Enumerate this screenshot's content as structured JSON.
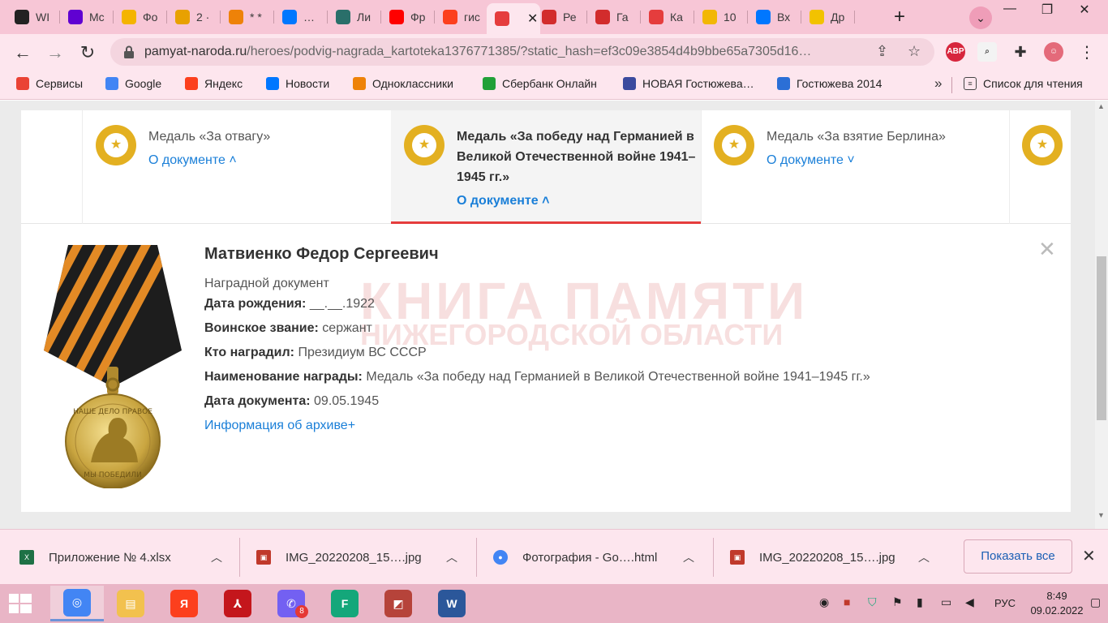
{
  "browser": {
    "tabs": [
      {
        "label": "WI",
        "icon": "github-icon",
        "color": "#222222"
      },
      {
        "label": "Mc",
        "icon": "yahoo-icon",
        "color": "#6001d2"
      },
      {
        "label": "Фо",
        "icon": "google-photos-icon",
        "color": "#f4b400"
      },
      {
        "label": "2 ·",
        "icon": "mail-icon",
        "color": "#e8a100"
      },
      {
        "label": "* *",
        "icon": "odnoklassniki-mail-icon",
        "color": "#ee8208"
      },
      {
        "label": "…",
        "icon": "vk-icon",
        "color": "#0077ff"
      },
      {
        "label": "Ли",
        "icon": "globe-icon",
        "color": "#2a6f6a"
      },
      {
        "label": "Фр",
        "icon": "youtube-icon",
        "color": "#ff0000"
      },
      {
        "label": "гис",
        "icon": "yandex-icon",
        "color": "#fc3f1d"
      },
      {
        "label": "",
        "icon": "star-outline-icon",
        "color": "#e53d3d",
        "active": true
      },
      {
        "label": "Ре",
        "icon": "ribbon-medal-icon",
        "color": "#d22c2c"
      },
      {
        "label": "Га",
        "icon": "ribbon-medal-icon",
        "color": "#d22c2c"
      },
      {
        "label": "Ка",
        "icon": "star-outline-icon",
        "color": "#e53d3d"
      },
      {
        "label": "10",
        "icon": "mountain-icon",
        "color": "#f2b705"
      },
      {
        "label": "Вх",
        "icon": "vk-icon",
        "color": "#0077ff"
      },
      {
        "label": "Др",
        "icon": "sun-icon",
        "color": "#f2c200"
      }
    ],
    "url_host": "pamyat-naroda.ru",
    "url_path": "/heroes/podvig-nagrada_kartoteka1376771385/?static_hash=ef3c09e3854d4b9bbe65a7305d16…",
    "extensions": [
      "ABP"
    ],
    "bookmarks": [
      {
        "label": "Сервисы",
        "icon": "apps-grid-icon",
        "color": "#ea4335"
      },
      {
        "label": "Google",
        "icon": "google-icon",
        "color": "#4285f4"
      },
      {
        "label": "Яндекс",
        "icon": "yandex-icon",
        "color": "#fc3f1d"
      },
      {
        "label": "Новости",
        "icon": "vk-icon",
        "color": "#0077ff"
      },
      {
        "label": "Одноклассники",
        "icon": "mail-icon",
        "color": "#ee8208"
      },
      {
        "label": "Сбербанк Онлайн",
        "icon": "sberbank-icon",
        "color": "#21a038"
      },
      {
        "label": "НОВАЯ Гостюжева…",
        "icon": "page-icon",
        "color": "#3b4a9e"
      },
      {
        "label": "Гостюжева 2014",
        "icon": "page-icon",
        "color": "#2b6fd6"
      }
    ],
    "bookmarks_more": "»",
    "reading_list": "Список для чтения"
  },
  "awards": {
    "tabs": [
      {
        "name": "Медаль «За отвагу»",
        "link": "О документе ˄",
        "active": false
      },
      {
        "name": "Медаль «За победу над Германией в Великой Отечественной войне 1941–1945 гг.»",
        "link": "О документе ˄",
        "active": true
      },
      {
        "name": "Медаль «За взятие Берлина»",
        "link": "О документе ˅",
        "active": false
      }
    ],
    "watermark_line1": "КНИГА ПАМЯТИ",
    "watermark_line2": "НИЖЕГОРОДСКОЙ ОБЛАСТИ",
    "person": {
      "name": "Матвиенко Федор Сергеевич",
      "doc_type": "Наградной документ",
      "fields": [
        {
          "label": "Дата рождения:",
          "value": "__.__.1922"
        },
        {
          "label": "Воинское звание:",
          "value": "сержант"
        },
        {
          "label": "Кто наградил:",
          "value": "Президиум ВС СССР"
        },
        {
          "label": "Наименование награды:",
          "value": "Медаль «За победу над Германией в Великой Отечественной войне 1941–1945 гг.»"
        },
        {
          "label": "Дата документа:",
          "value": "09.05.1945"
        }
      ],
      "archive_link": "Информация об архиве+"
    },
    "medal_inscription_top": "НАШЕ ДЕЛО ПРАВОЕ",
    "medal_inscription_bottom": "МЫ ПОБЕДИЛИ"
  },
  "downloads": {
    "items": [
      {
        "name": "Приложение № 4.xlsx",
        "icon": "excel-file-icon",
        "color": "#1e7145"
      },
      {
        "name": "IMG_20220208_15….jpg",
        "icon": "image-file-icon",
        "color": "#c0392b"
      },
      {
        "name": "Фотография - Go….html",
        "icon": "chrome-icon",
        "color": "#4285f4"
      },
      {
        "name": "IMG_20220208_15….jpg",
        "icon": "image-file-icon",
        "color": "#c0392b"
      }
    ],
    "show_all": "Показать все"
  },
  "taskbar": {
    "apps": [
      {
        "icon": "chrome-icon",
        "color": "#4285f4",
        "active": true
      },
      {
        "icon": "file-explorer-icon",
        "color": "#f2c14e",
        "active": false
      },
      {
        "icon": "yandex-browser-icon",
        "color": "#fc3f1d",
        "active": false
      },
      {
        "icon": "acrobat-reader-icon",
        "color": "#c4161c",
        "active": false
      },
      {
        "icon": "viber-icon",
        "color": "#7360f2",
        "active": false,
        "badge": "8"
      },
      {
        "icon": "free-vpn-icon",
        "color": "#14a77a",
        "active": false
      },
      {
        "icon": "image-viewer-icon",
        "color": "#b6433a",
        "active": false
      },
      {
        "icon": "word-icon",
        "color": "#2b579a",
        "active": false
      }
    ],
    "lang": "РУС",
    "time": "8:49",
    "date": "09.02.2022"
  }
}
